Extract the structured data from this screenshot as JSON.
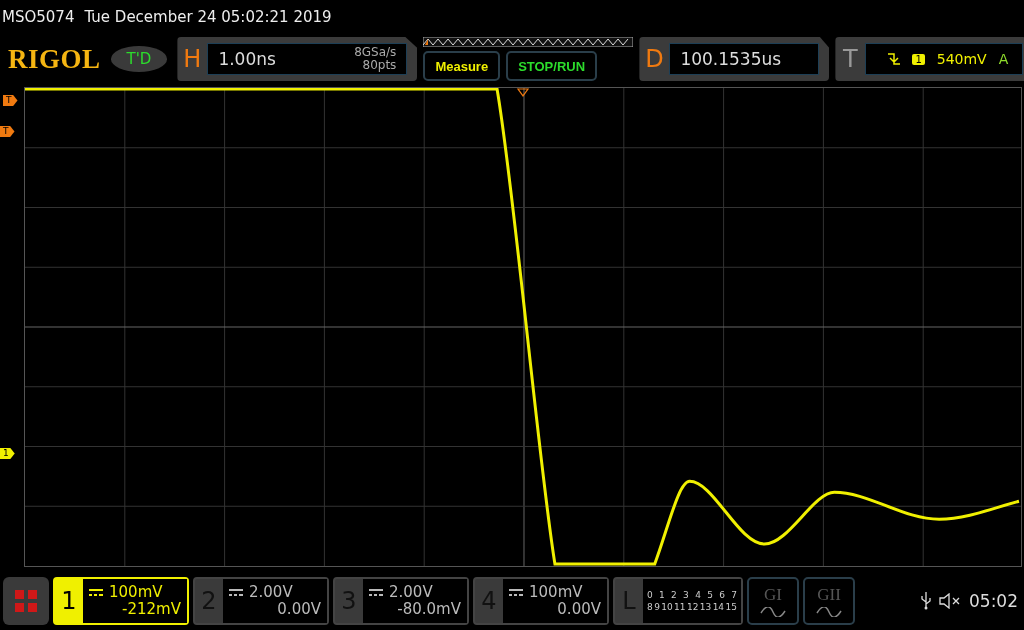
{
  "header": {
    "model": "MSO5074",
    "datetime": "Tue December 24 05:02:21 2019"
  },
  "toolbar": {
    "logo": "RIGOL",
    "mode_badge": "T'D",
    "horizontal": {
      "letter": "H",
      "timebase": "1.00ns",
      "sample_rate": "8GSa/s",
      "points": "80pts"
    },
    "measure_button": "Measure",
    "stop_run_button": "STOP/RUN",
    "delay": {
      "letter": "D",
      "value": "100.1535us"
    },
    "trigger": {
      "letter": "T",
      "source": "1",
      "level": "540mV",
      "sweep": "A"
    }
  },
  "markers": [
    {
      "label": "T",
      "kind": "trigger-position"
    },
    {
      "label": "T",
      "kind": "trigger-level"
    },
    {
      "label": "1",
      "kind": "channel"
    }
  ],
  "channels": [
    {
      "number": "1",
      "scale": "100mV",
      "offset": "-212mV",
      "selected": true
    },
    {
      "number": "2",
      "scale": "2.00V",
      "offset": "0.00V",
      "selected": false
    },
    {
      "number": "3",
      "scale": "2.00V",
      "offset": "-80.0mV",
      "selected": false
    },
    {
      "number": "4",
      "scale": "100mV",
      "offset": "0.00V",
      "selected": false
    }
  ],
  "logic": {
    "letter": "L",
    "rows": [
      [
        "0",
        "1",
        "2",
        "3",
        "4",
        "5",
        "6",
        "7"
      ],
      [
        "8",
        "9",
        "10",
        "11",
        "12",
        "13",
        "14",
        "15"
      ]
    ]
  },
  "generators": [
    "GI",
    "GII"
  ],
  "status": {
    "time": "05:02"
  }
}
